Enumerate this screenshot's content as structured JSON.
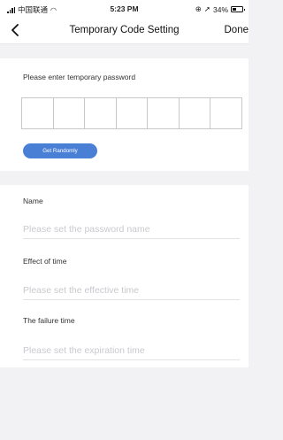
{
  "status_bar": {
    "carrier": "中国联通",
    "time": "5:23 PM",
    "battery": "34%"
  },
  "nav": {
    "title": "Temporary Code Setting",
    "done_label": "Done"
  },
  "password": {
    "prompt": "Please enter temporary password",
    "cells": 7,
    "random_button": "Get Randomly"
  },
  "form": {
    "name_label": "Name",
    "name_placeholder": "Please set the password name",
    "effect_label": "Effect of time",
    "effect_placeholder": "Please set the effective time",
    "failure_label": "The failure time",
    "failure_placeholder": "Please set the expiration time"
  },
  "colors": {
    "accent": "#4a7fd6",
    "background": "#f2f2f4"
  }
}
